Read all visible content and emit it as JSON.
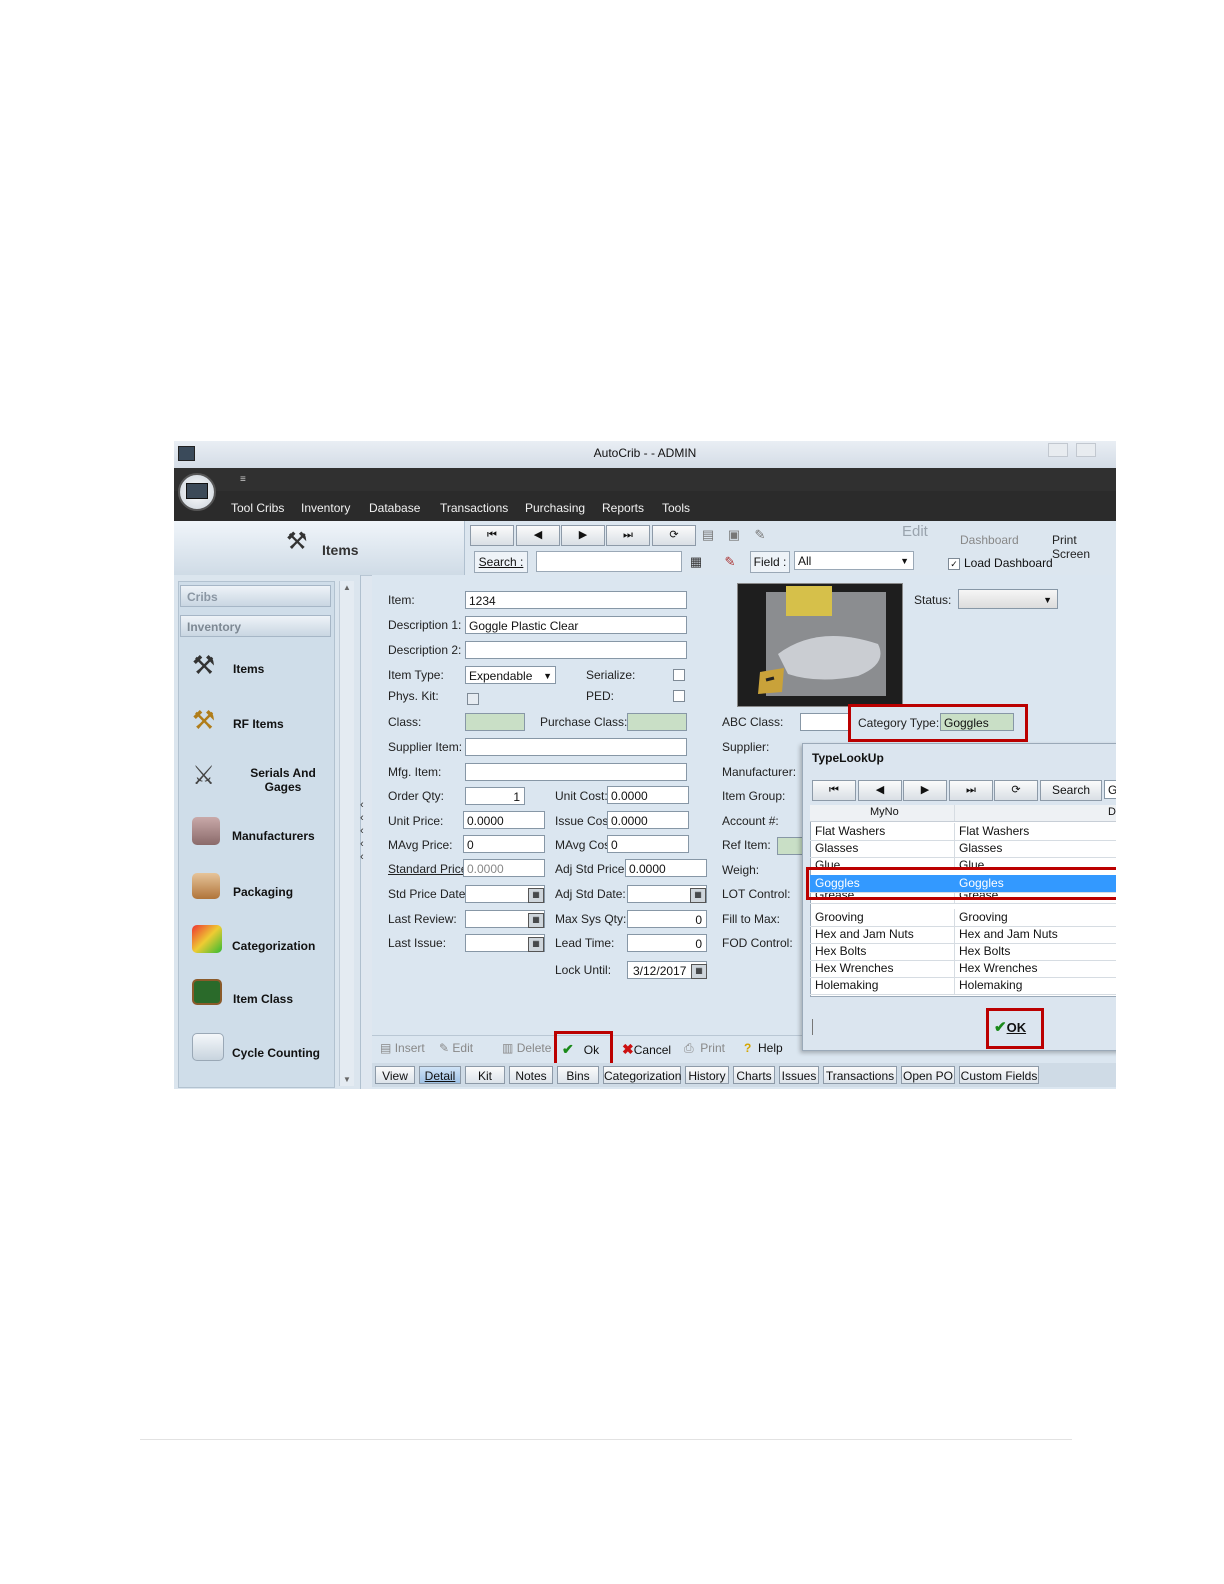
{
  "window": {
    "title": "AutoCrib -  - ADMIN"
  },
  "ribbon": {
    "quick_access": "≡"
  },
  "menu": [
    "Tool Cribs",
    "Inventory",
    "Database",
    "Transactions",
    "Purchasing",
    "Reports",
    "Tools"
  ],
  "header": {
    "title": "Items"
  },
  "toolbar": {
    "edit_label": "Edit",
    "dashboard_label": "Dashboard",
    "print_screen_label": "Print Screen",
    "load_dashboard_label": "Load Dashboard",
    "load_dashboard_checked": true,
    "search_label": "Search :",
    "search_value": "",
    "field_label": "Field :",
    "field_value": "All"
  },
  "sidebar": {
    "tabs": [
      "Cribs",
      "Inventory"
    ],
    "items": [
      {
        "label": "Items",
        "icon": "hammer-wrench-icon"
      },
      {
        "label": "RF Items",
        "icon": "rf-tools-icon"
      },
      {
        "label": "Serials And Gages",
        "icon": "gages-icon"
      },
      {
        "label": "Manufacturers",
        "icon": "factory-icon"
      },
      {
        "label": "Packaging",
        "icon": "box-icon"
      },
      {
        "label": "Categorization",
        "icon": "cubes-icon"
      },
      {
        "label": "Item Class",
        "icon": "chalkboard-icon"
      },
      {
        "label": "Cycle Counting",
        "icon": "calendar-icon"
      }
    ]
  },
  "form": {
    "item_label": "Item:",
    "item_value": "1234",
    "desc1_label": "Description 1:",
    "desc1_value": "Goggle Plastic Clear",
    "desc2_label": "Description 2:",
    "desc2_value": "",
    "item_type_label": "Item Type:",
    "item_type_value": "Expendable",
    "serialize_label": "Serialize:",
    "phys_kit_label": "Phys. Kit:",
    "ped_label": "PED:",
    "class_label": "Class:",
    "purchase_class_label": "Purchase Class:",
    "supplier_item_label": "Supplier Item:",
    "mfg_item_label": "Mfg. Item:",
    "order_qty_label": "Order Qty:",
    "order_qty_value": "1",
    "unit_cost_label": "Unit Cost:",
    "unit_cost_value": "0.0000",
    "unit_price_label": "Unit Price:",
    "unit_price_value": "0.0000",
    "issue_cost_label": "Issue Cost:",
    "issue_cost_value": "0.0000",
    "mavg_price_label": "MAvg Price:",
    "mavg_price_value": "0",
    "mavg_cost_label": "MAvg Cost:",
    "mavg_cost_value": "0",
    "std_price_label": "Standard Price:",
    "std_price_value": "0.0000",
    "adj_std_price_label": "Adj Std Price:",
    "adj_std_price_value": "0.0000",
    "std_price_date_label": "Std Price Date:",
    "adj_std_date_label": "Adj Std Date:",
    "last_review_label": "Last Review:",
    "max_sys_qty_label": "Max Sys Qty:",
    "max_sys_qty_value": "0",
    "last_issue_label": "Last Issue:",
    "lead_time_label": "Lead Time:",
    "lead_time_value": "0",
    "lock_until_label": "Lock Until:",
    "lock_until_value": "3/12/2017",
    "status_label": "Status:",
    "abc_class_label": "ABC Class:",
    "category_type_label": "Category Type:",
    "category_type_value": "Goggles",
    "supplier_label": "Supplier:",
    "manufacturer_label": "Manufacturer:",
    "item_group_label": "Item Group:",
    "account_label": "Account #:",
    "ref_item_label": "Ref Item:",
    "weigh_label": "Weigh:",
    "lot_control_label": "LOT Control:",
    "fill_to_max_label": "Fill to Max:",
    "fod_control_label": "FOD Control:"
  },
  "actions": {
    "insert": "Insert",
    "edit": "Edit",
    "delete": "Delete",
    "ok": "Ok",
    "cancel": "Cancel",
    "print": "Print",
    "help": "Help"
  },
  "tabs": [
    "View",
    "Detail",
    "Kit",
    "Notes",
    "Bins",
    "Categorization",
    "History",
    "Charts",
    "Issues",
    "Transactions",
    "Open PO",
    "Custom Fields"
  ],
  "active_tab": "Detail",
  "lookup": {
    "title": "TypeLookUp",
    "search_label": "Search",
    "search_value": "G",
    "col1": "MyNo",
    "col2": "D",
    "rows": [
      [
        "Flat Washers",
        "Flat Washers"
      ],
      [
        "Glasses",
        "Glasses"
      ],
      [
        "Glue",
        "Glue"
      ],
      [
        "Goggles",
        "Goggles"
      ],
      [
        "Grease",
        "Grease"
      ],
      [
        "Grooving",
        "Grooving"
      ],
      [
        "Hex and Jam Nuts",
        "Hex and Jam Nuts"
      ],
      [
        "Hex Bolts",
        "Hex Bolts"
      ],
      [
        "Hex Wrenches",
        "Hex Wrenches"
      ],
      [
        "Holemaking",
        "Holemaking"
      ]
    ],
    "selected_row": "Goggles",
    "ok_label": "OK"
  },
  "colors": {
    "highlight": "#b00000",
    "selection": "#3399ff",
    "ok_check": "#1a8a1a",
    "cancel_x": "#cc1111"
  }
}
